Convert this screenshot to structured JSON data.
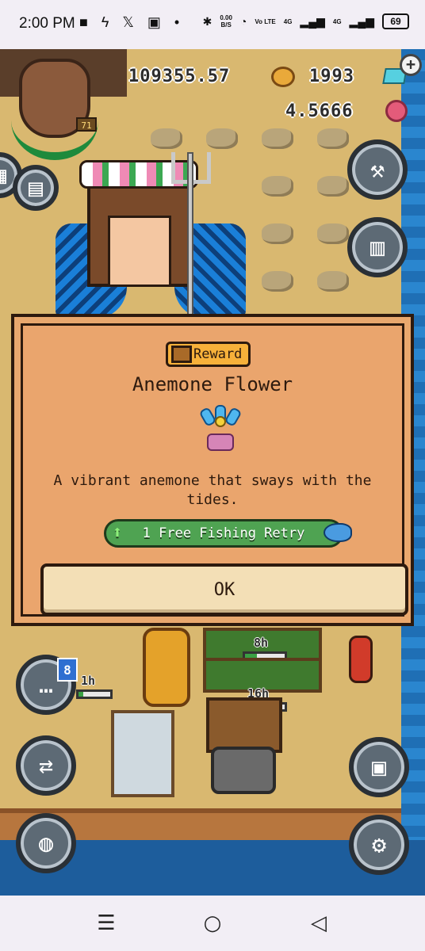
{
  "status_bar": {
    "time": "2:00 PM",
    "net_speed_value": "0.00",
    "net_speed_unit": "B/S",
    "volte": "Vo LTE",
    "network_1": "4G",
    "network_2": "4G",
    "battery": "69"
  },
  "hud": {
    "coins": "109355.57",
    "gems": "1993",
    "flowers": "4.5666",
    "level": "71"
  },
  "timers": {
    "plot_1": "8h",
    "plot_2": "16h",
    "side": "1h"
  },
  "chat_badge": "8",
  "dialog": {
    "tag": "Reward",
    "title": "Anemone Flower",
    "description": "A vibrant anemone that sways with the tides.",
    "perk": "1 Free Fishing Retry",
    "ok_label": "OK"
  },
  "colors": {
    "dialog_bg": "#e9a86e",
    "reward_tag": "#f7b13a",
    "perk_green": "#4fa352",
    "ok_bg": "#f3dfb6"
  },
  "icons": {
    "menu": "recent-apps-icon",
    "home": "home-icon",
    "back": "back-icon"
  }
}
